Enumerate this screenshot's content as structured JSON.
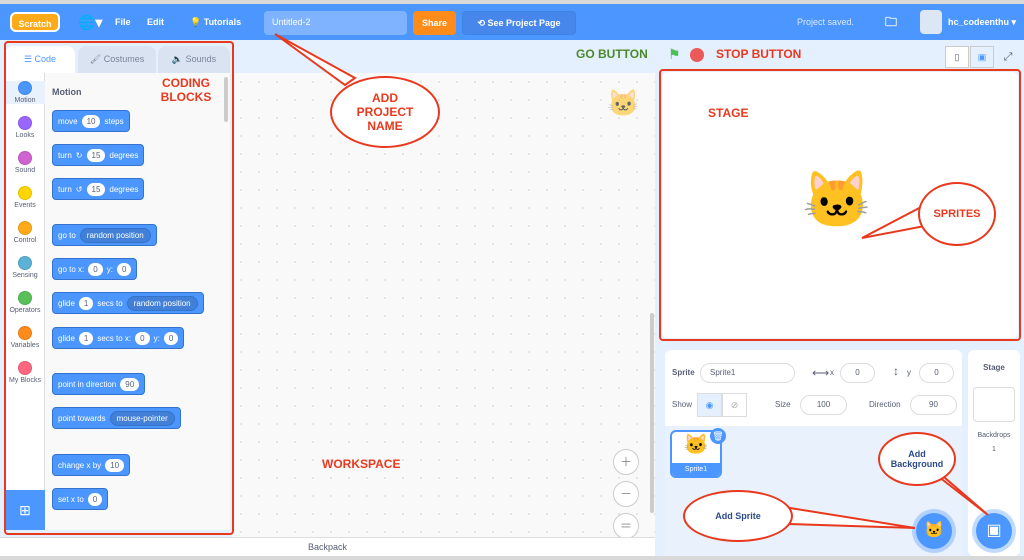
{
  "menubar": {
    "logo": "Scratch",
    "file": "File",
    "edit": "Edit",
    "tutorials": "Tutorials",
    "project_title": "Untitled-2",
    "share": "Share",
    "see_project_page": "See Project Page",
    "status": "Project saved.",
    "username": "hc_codeenthu"
  },
  "tabs": [
    {
      "label": "Code"
    },
    {
      "label": "Costumes"
    },
    {
      "label": "Sounds"
    }
  ],
  "categories": [
    {
      "label": "Motion",
      "color": "#4c97ff"
    },
    {
      "label": "Looks",
      "color": "#9966ff"
    },
    {
      "label": "Sound",
      "color": "#cf63cf"
    },
    {
      "label": "Events",
      "color": "#ffd500"
    },
    {
      "label": "Control",
      "color": "#ffab19"
    },
    {
      "label": "Sensing",
      "color": "#5cb1d6"
    },
    {
      "label": "Operators",
      "color": "#59c059"
    },
    {
      "label": "Variables",
      "color": "#ff8c1a"
    },
    {
      "label": "My Blocks",
      "color": "#ff6680"
    }
  ],
  "palette": {
    "heading": "Motion",
    "blocks": {
      "move": {
        "a": "move",
        "v": "10",
        "b": "steps"
      },
      "turn_right": {
        "a": "turn",
        "v": "15",
        "b": "degrees"
      },
      "turn_left": {
        "a": "turn",
        "v": "15",
        "b": "degrees"
      },
      "goto": {
        "a": "go to",
        "d": "random position"
      },
      "gotoxy": {
        "a": "go to x:",
        "x": "0",
        "y_label": "y:",
        "y": "0"
      },
      "glide_to": {
        "a": "glide",
        "v": "1",
        "b": "secs to",
        "d": "random position"
      },
      "glide_xy": {
        "a": "glide",
        "v": "1",
        "b": "secs to x:",
        "x": "0",
        "y_label": "y:",
        "y": "0"
      },
      "point_dir": {
        "a": "point in direction",
        "v": "90"
      },
      "point_towards": {
        "a": "point towards",
        "d": "mouse-pointer"
      },
      "change_x": {
        "a": "change x by",
        "v": "10"
      },
      "set_x": {
        "a": "set x to",
        "v": "0"
      }
    }
  },
  "workspace": {
    "backpack": "Backpack"
  },
  "sprite_info": {
    "sprite_label": "Sprite",
    "sprite_name": "Sprite1",
    "x_label": "x",
    "x": "0",
    "y_label": "y",
    "y": "0",
    "show_label": "Show",
    "size_label": "Size",
    "size": "100",
    "direction_label": "Direction",
    "direction": "90"
  },
  "sprite_list": [
    {
      "name": "Sprite1"
    }
  ],
  "stage_pane": {
    "title": "Stage",
    "backdrops_label": "Backdrops",
    "backdrops_count": "1"
  },
  "annotations": {
    "coding_blocks": "CODING BLOCKS",
    "add_project_name": "ADD PROJECT NAME",
    "go_button": "GO BUTTON",
    "stop_button": "STOP BUTTON",
    "stage": "STAGE",
    "sprites": "SPRITES",
    "workspace": "WORKSPACE",
    "add_sprite": "Add Sprite",
    "add_background": "Add Background",
    "color": "#e8391e",
    "go_color": "#4a8a2a"
  }
}
